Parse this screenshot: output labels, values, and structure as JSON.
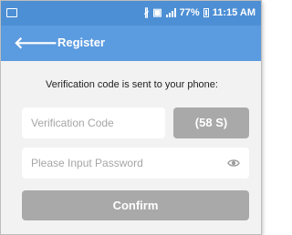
{
  "status_bar": {
    "battery_percent": "77%",
    "time": "11:15 AM",
    "icons": [
      "screenshot-icon",
      "bluetooth-icon",
      "vibrate-icon",
      "signal-icon",
      "battery-icon"
    ]
  },
  "app_bar": {
    "back_icon": "back-arrow-icon",
    "back_glyph": "🡐",
    "title": "Register",
    "color": "#5b9be0"
  },
  "form": {
    "message": "Verification code is sent to your phone:",
    "verification_code": {
      "value": "",
      "placeholder": "Verification Code"
    },
    "resend_timer_label": "(58 S)",
    "password": {
      "value": "",
      "placeholder": "Please Input Password",
      "toggle_icon": "eye-icon"
    },
    "confirm_label": "Confirm"
  },
  "colors": {
    "status_bar": "#4d8fd5",
    "button_disabled": "#a9a9a9",
    "background": "#f2f2f2"
  }
}
